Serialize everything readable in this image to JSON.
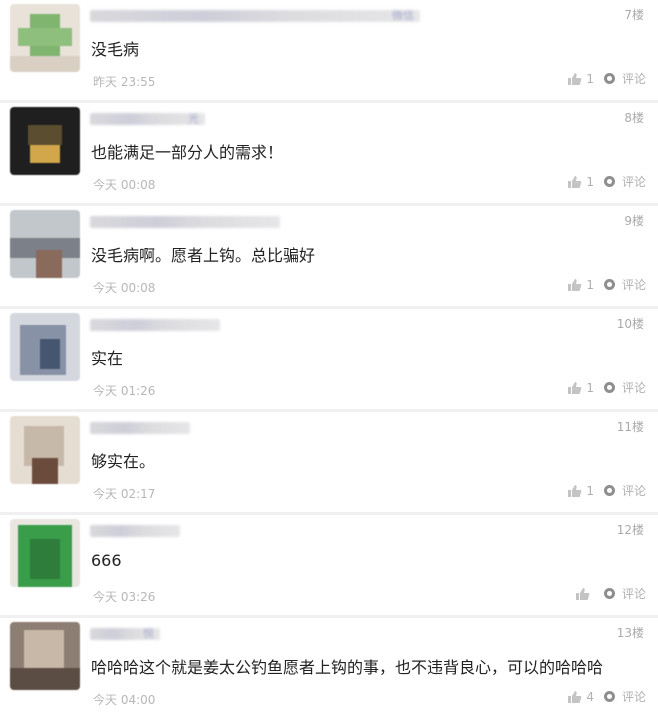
{
  "like_label_visible": true,
  "reply_label": "评论",
  "comments": [
    {
      "floor": "7楼",
      "name_hint": "微信",
      "text": "没毛病",
      "time": "昨天 23:55",
      "likes": "1",
      "avatar_colors": [
        "#e8e2d9",
        "#7fb56e",
        "#a7a38f"
      ]
    },
    {
      "floor": "8楼",
      "name_hint": "光",
      "text": "也能满足一部分人的需求！",
      "time": "今天 00:08",
      "likes": "1",
      "avatar_colors": [
        "#222222",
        "#5a4d30",
        "#d2a64a"
      ]
    },
    {
      "floor": "9楼",
      "name_hint": "",
      "text": "没毛病啊。愿者上钩。总比骗好",
      "time": "今天 00:08",
      "likes": "1",
      "avatar_colors": [
        "#c2c7cc",
        "#7b8089",
        "#8a6a5a"
      ]
    },
    {
      "floor": "10楼",
      "name_hint": "",
      "text": "实在",
      "time": "今天 01:26",
      "likes": "1",
      "avatar_colors": [
        "#b9c1cd",
        "#465570",
        "#d4d8de"
      ]
    },
    {
      "floor": "11楼",
      "name_hint": "",
      "text": "够实在。",
      "time": "今天 02:17",
      "likes": "1",
      "avatar_colors": [
        "#c7b9a9",
        "#6b4b3c",
        "#e6ddd2"
      ]
    },
    {
      "floor": "12楼",
      "name_hint": "",
      "text": "666",
      "time": "今天 03:26",
      "likes": "",
      "avatar_colors": [
        "#3a9d4a",
        "#2e7d3a",
        "#e9e6e0"
      ]
    },
    {
      "floor": "13楼",
      "name_hint": "悦",
      "text": "哈哈哈这个就是姜太公钓鱼愿者上钩的事，也不违背良心，可以的哈哈哈",
      "time": "今天 04:00",
      "likes": "4",
      "avatar_colors": [
        "#8c7e73",
        "#c8b8a8",
        "#5b4d44"
      ]
    }
  ]
}
